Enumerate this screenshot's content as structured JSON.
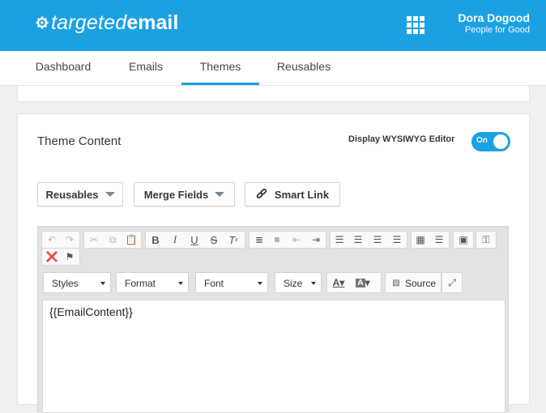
{
  "header": {
    "logo_thin": "targeted",
    "logo_bold": "email",
    "user_name": "Dora Dogood",
    "user_org": "People for Good",
    "brand_color": "#1ba1e2"
  },
  "nav": {
    "tabs": [
      {
        "label": "Dashboard",
        "active": false
      },
      {
        "label": "Emails",
        "active": false
      },
      {
        "label": "Themes",
        "active": true
      },
      {
        "label": "Reusables",
        "active": false
      }
    ]
  },
  "theme_content": {
    "title": "Theme Content",
    "wysiwyg_label": "Display WYSIWYG Editor",
    "toggle_label": "On",
    "buttons": {
      "reusables": "Reusables",
      "merge_fields": "Merge Fields",
      "smart_link": "Smart Link"
    }
  },
  "editor": {
    "combos": {
      "styles": "Styles",
      "format": "Format",
      "font": "Font",
      "size": "Size"
    },
    "source_label": "Source",
    "toolbar_icons": [
      "undo-icon",
      "redo-icon",
      "cut-icon",
      "copy-icon",
      "paste-icon",
      "bold-icon",
      "italic-icon",
      "underline-icon",
      "strikethrough-icon",
      "remove-format-icon",
      "numbered-list-icon",
      "bulleted-list-icon",
      "outdent-icon",
      "indent-icon",
      "align-left-icon",
      "align-center-icon",
      "align-right-icon",
      "justify-icon",
      "table-icon",
      "horizontal-rule-icon",
      "image-icon",
      "link-icon",
      "unlink-icon",
      "anchor-flag-icon",
      "text-color-icon",
      "background-color-icon",
      "source-icon",
      "maximize-icon"
    ],
    "content": "{{EmailContent}}"
  }
}
